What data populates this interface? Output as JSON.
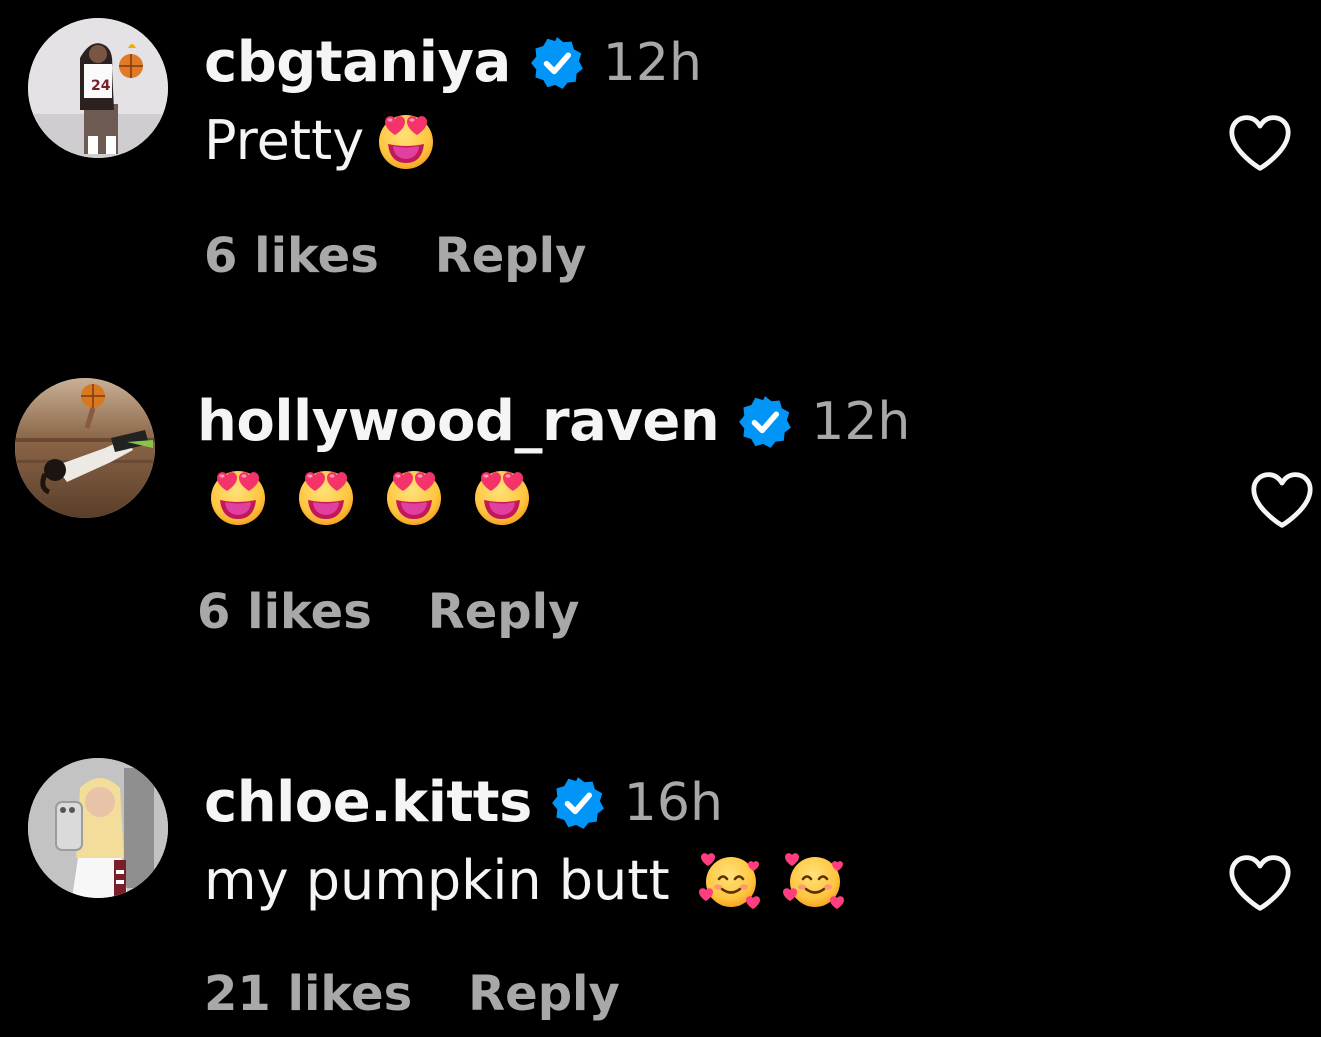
{
  "colors": {
    "background": "#000000",
    "text_primary": "#f5f5f5",
    "text_secondary": "#a8a8a8",
    "verified_badge": "#0095f6"
  },
  "comments": [
    {
      "username": "cbgtaniya",
      "verified_icon": "verified-badge-icon",
      "time": "12h",
      "text": "Pretty",
      "emojis": [
        "heart-eyes-emoji"
      ],
      "likes": "6 likes",
      "reply_label": "Reply",
      "like_icon": "heart-outline-icon"
    },
    {
      "username": "hollywood_raven",
      "verified_icon": "verified-badge-icon",
      "time": "12h",
      "text": "",
      "emojis": [
        "heart-eyes-emoji",
        "heart-eyes-emoji",
        "heart-eyes-emoji",
        "heart-eyes-emoji"
      ],
      "likes": "6 likes",
      "reply_label": "Reply",
      "like_icon": "heart-outline-icon"
    },
    {
      "username": "chloe.kitts",
      "verified_icon": "verified-badge-icon",
      "time": "16h",
      "text": "my pumpkin butt",
      "emojis": [
        "smiling-face-with-hearts-emoji",
        "smiling-face-with-hearts-emoji"
      ],
      "likes": "21 likes",
      "reply_label": "Reply",
      "like_icon": "heart-outline-icon"
    }
  ]
}
